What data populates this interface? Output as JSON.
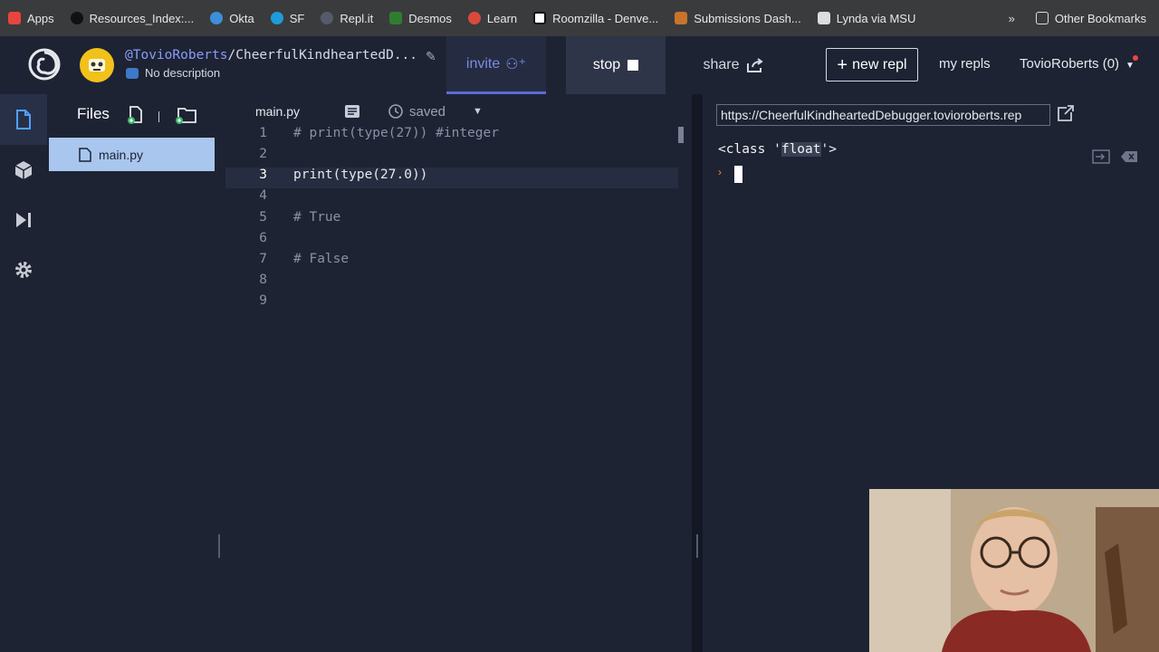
{
  "bookmarks": {
    "items": [
      {
        "label": "Apps",
        "color": "#e8453c"
      },
      {
        "label": "Resources_Index:...",
        "color": "#222222"
      },
      {
        "label": "Okta",
        "color": "#3b8fd9"
      },
      {
        "label": "SF",
        "color": "#1f9bd9"
      },
      {
        "label": "Repl.it",
        "color": "#555b6b"
      },
      {
        "label": "Desmos",
        "color": "#2e7d32"
      },
      {
        "label": "Learn",
        "color": "#333333"
      },
      {
        "label": "Roomzilla - Denve...",
        "color": "#222222"
      },
      {
        "label": "Submissions Dash...",
        "color": "#c8742c"
      },
      {
        "label": "Lynda via MSU",
        "color": "#6b6b8a"
      }
    ],
    "more": "»",
    "other": "Other Bookmarks"
  },
  "header": {
    "username": "@TovioRoberts",
    "repl_name": "/CheerfulKindheartedD...",
    "description": "No description",
    "invite_label": "invite",
    "stop_label": "stop",
    "share_label": "share",
    "new_repl_label": "new repl",
    "my_repls_label": "my repls",
    "account_label": "TovioRoberts (0)"
  },
  "files": {
    "title": "Files",
    "items": [
      {
        "name": "main.py",
        "selected": true
      }
    ]
  },
  "editor": {
    "tab": "main.py",
    "status": "saved",
    "lines": [
      {
        "num": "1",
        "text": "# print(type(27)) #integer"
      },
      {
        "num": "2",
        "text": ""
      },
      {
        "num": "3",
        "text": "print(type(27.0))"
      },
      {
        "num": "4",
        "text": ""
      },
      {
        "num": "5",
        "text": "# True"
      },
      {
        "num": "6",
        "text": ""
      },
      {
        "num": "7",
        "text": "# False"
      },
      {
        "num": "8",
        "text": ""
      },
      {
        "num": "9",
        "text": ""
      }
    ]
  },
  "console": {
    "url": "https://CheerfulKindheartedDebugger.tovioroberts.rep",
    "output_pre": "<class '",
    "output_hl": "float",
    "output_post": "'>",
    "prompt": "›"
  },
  "colors": {
    "accent": "#5a6ad8",
    "background": "#1d2333",
    "selected_file": "#a9c6ee"
  }
}
